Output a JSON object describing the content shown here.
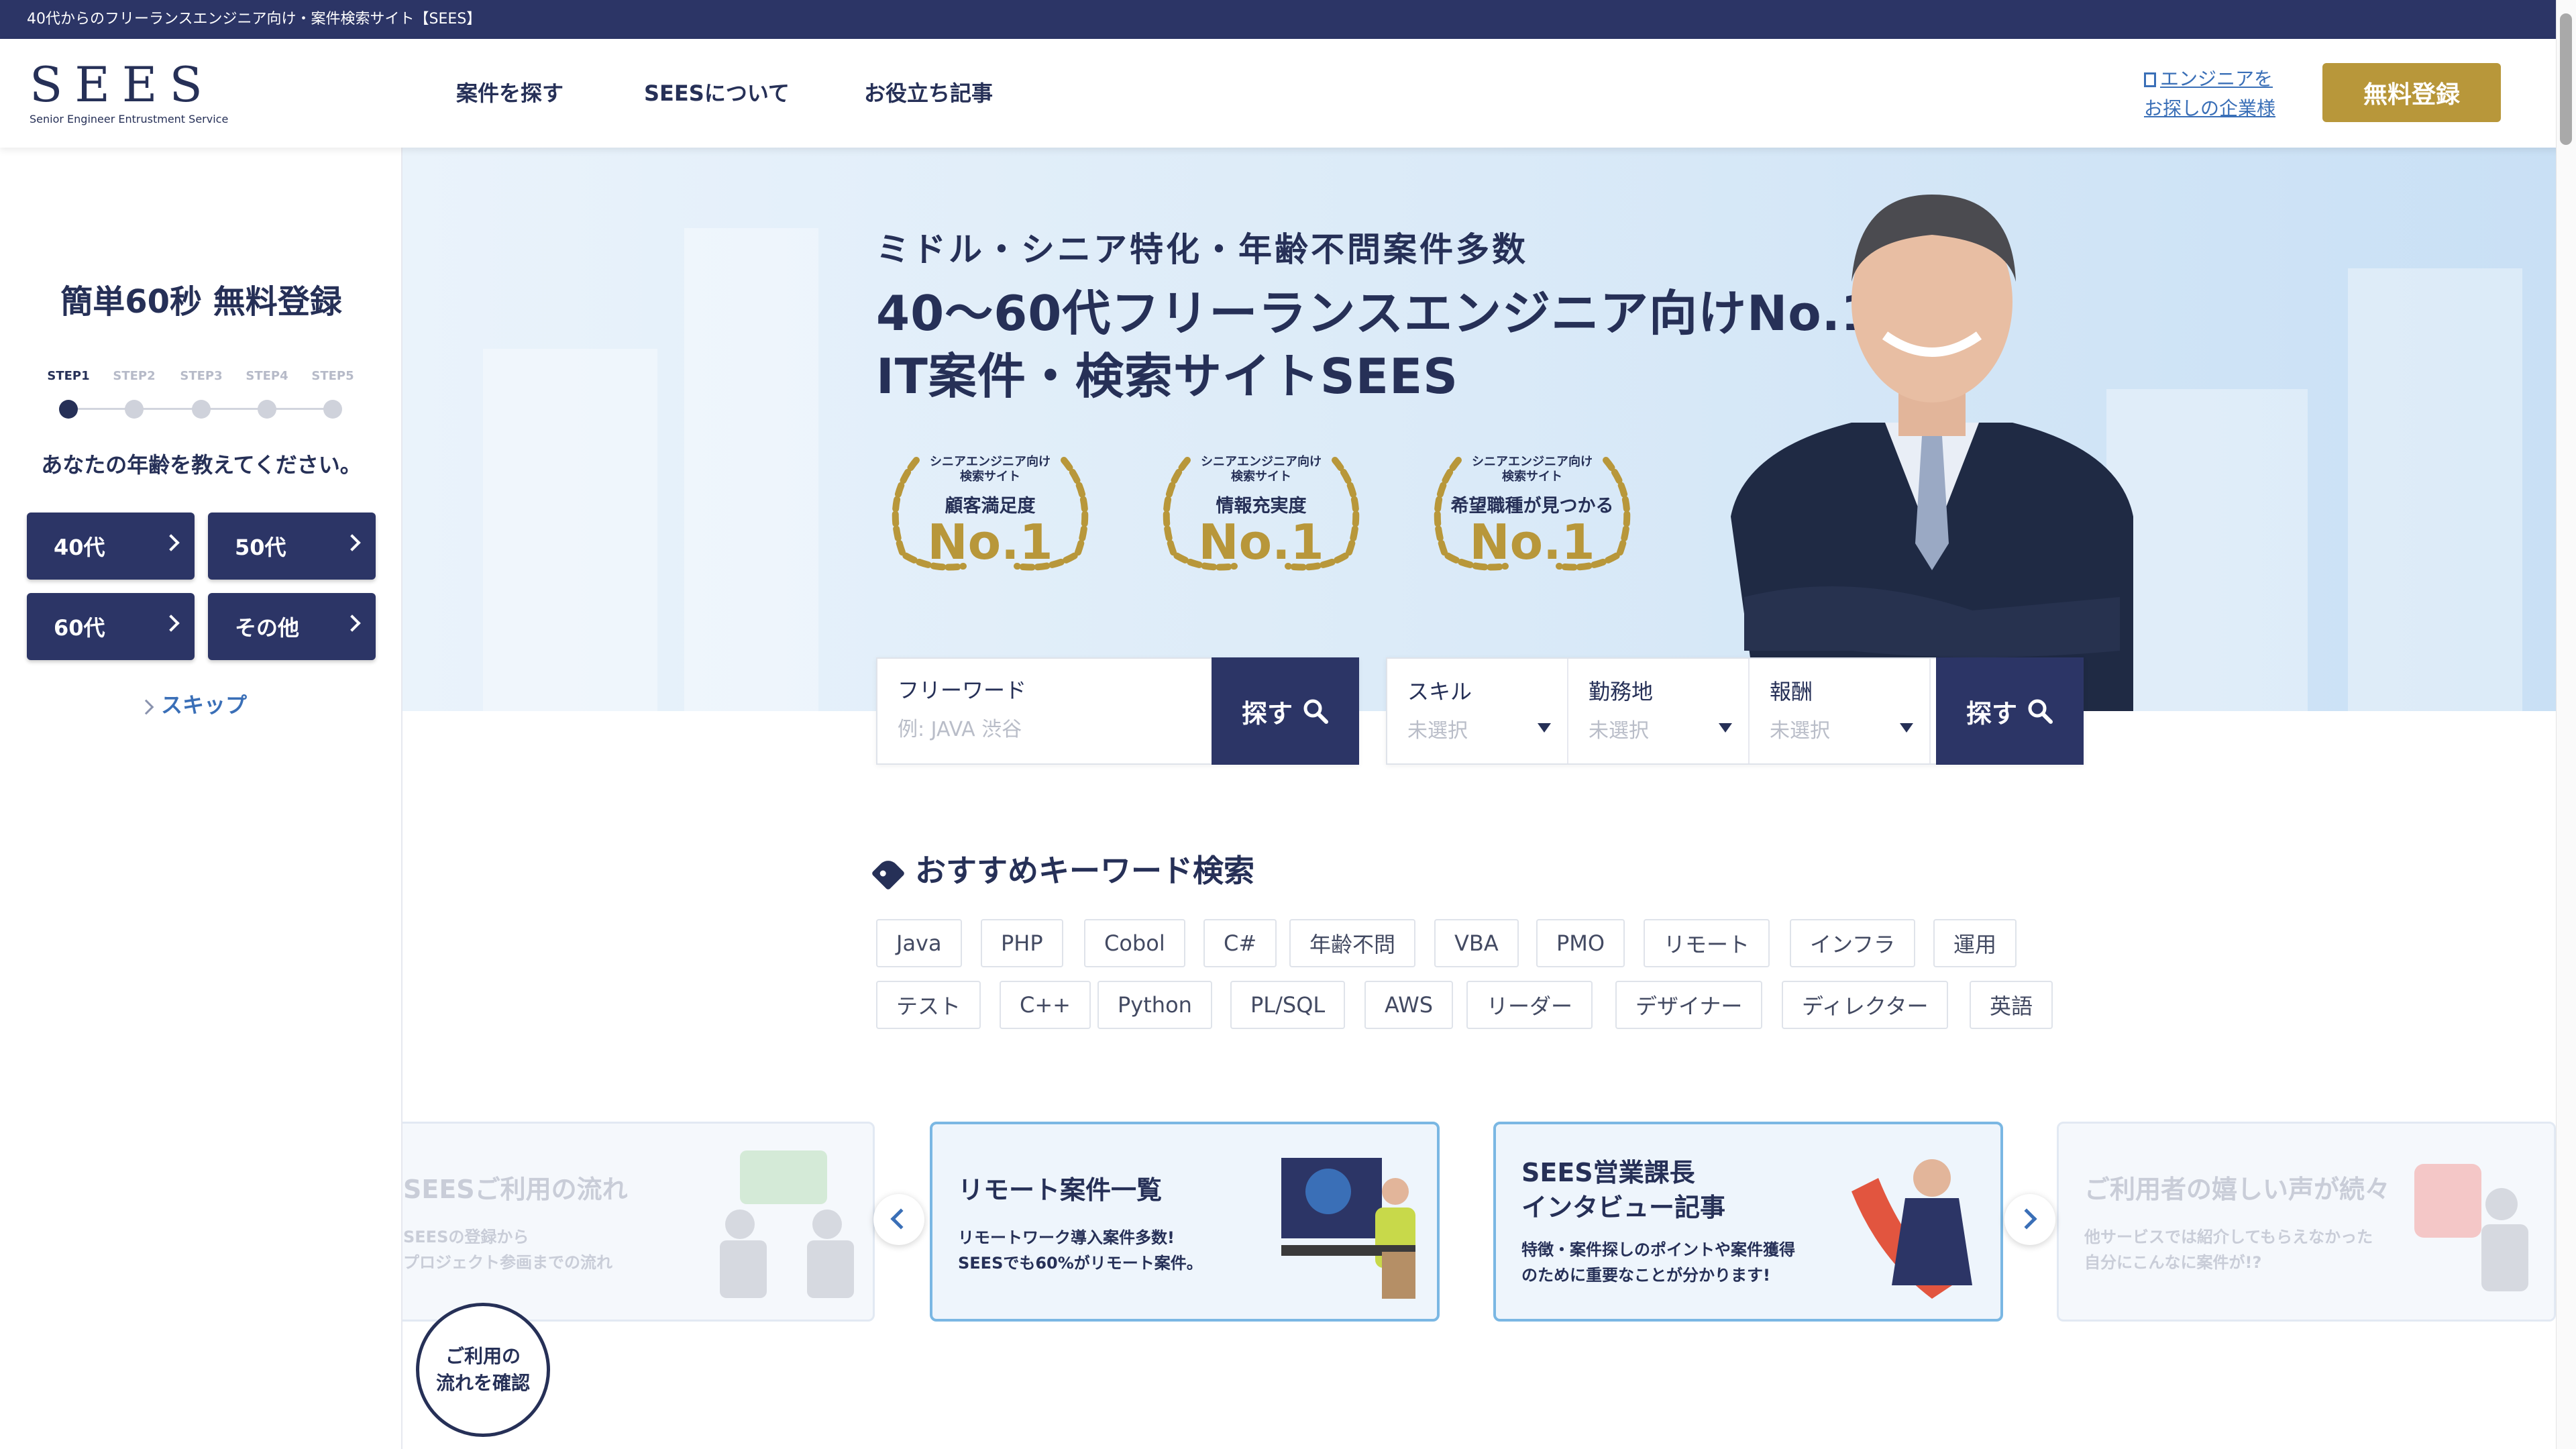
{
  "top_strip": {
    "text": "40代からのフリーランスエンジニア向け・案件検索サイト【SEES】"
  },
  "header": {
    "logo_mark": "SEES",
    "logo_sub": "Senior Engineer Entrustment Service",
    "nav": [
      {
        "label": "案件を探す"
      },
      {
        "label": "SEESについて"
      },
      {
        "label": "お役立ち記事"
      }
    ],
    "corp_link_line1": "エンジニアを",
    "corp_link_line2": "お探しの企業様",
    "register_label": "無料登録"
  },
  "sidebar": {
    "title": "簡単60秒 無料登録",
    "steps": [
      {
        "label": "STEP1"
      },
      {
        "label": "STEP2"
      },
      {
        "label": "STEP3"
      },
      {
        "label": "STEP4"
      },
      {
        "label": "STEP5"
      }
    ],
    "current_step": 1,
    "question": "あなたの年齢を教えてください。",
    "age_options": [
      {
        "label": "40代"
      },
      {
        "label": "50代"
      },
      {
        "label": "60代"
      },
      {
        "label": "その他"
      }
    ],
    "skip_label": "スキップ",
    "flow_button_line1": "ご利用の",
    "flow_button_line2": "流れを確認"
  },
  "hero": {
    "sub_heading": "ミドル・シニア特化・年齢不問案件多数",
    "main_heading_line1": "40〜60代フリーランスエンジニア向けNo.1",
    "main_heading_line2": "IT案件・検索サイトSEES",
    "awards": [
      {
        "line1": "シニアエンジニア向け",
        "line2": "検索サイト",
        "category": "顧客満足度",
        "rank": "No.1"
      },
      {
        "line1": "シニアエンジニア向け",
        "line2": "検索サイト",
        "category": "情報充実度",
        "rank": "No.1"
      },
      {
        "line1": "シニアエンジニア向け",
        "line2": "検索サイト",
        "category": "希望職種が見つかる",
        "rank": "No.1"
      }
    ]
  },
  "search_free": {
    "label": "フリーワード",
    "placeholder": "例: JAVA 渋谷",
    "button_label": "探す"
  },
  "search_filters": {
    "filters": [
      {
        "label": "スキル",
        "value": "未選択"
      },
      {
        "label": "勤務地",
        "value": "未選択"
      },
      {
        "label": "報酬",
        "value": "未選択"
      }
    ],
    "button_label": "探す"
  },
  "keywords": {
    "title": "おすすめキーワード検索",
    "row1": [
      "Java",
      "PHP",
      "Cobol",
      "C#",
      "年齢不問",
      "VBA",
      "PMO",
      "リモート",
      "インフラ",
      "運用"
    ],
    "row2": [
      "テスト",
      "C++",
      "Python",
      "PL/SQL",
      "AWS",
      "リーダー",
      "デザイナー",
      "ディレクター",
      "英語"
    ]
  },
  "cards": [
    {
      "title": "SEESご利用の流れ",
      "desc1": "SEESの登録から",
      "desc2": "プロジェクト参画までの流れ"
    },
    {
      "title": "リモート案件一覧",
      "desc1": "リモートワーク導入案件多数!",
      "desc2": "SEESでも60%がリモート案件。"
    },
    {
      "title_line1": "SEES営業課長",
      "title_line2": "インタビュー記事",
      "desc1": "特徴・案件探しのポイントや案件獲得",
      "desc2": "のために重要なことが分かります!"
    },
    {
      "title": "ご利用者の嬉しい声が続々",
      "desc1": "他サービスでは紹介してもらえなかった",
      "desc2": "自分にこんなに案件が!?"
    }
  ],
  "colors": {
    "navy": "#2c3566",
    "gold": "#b8973a",
    "link_blue": "#3a6fb7",
    "card_border": "#7ab7e3"
  }
}
